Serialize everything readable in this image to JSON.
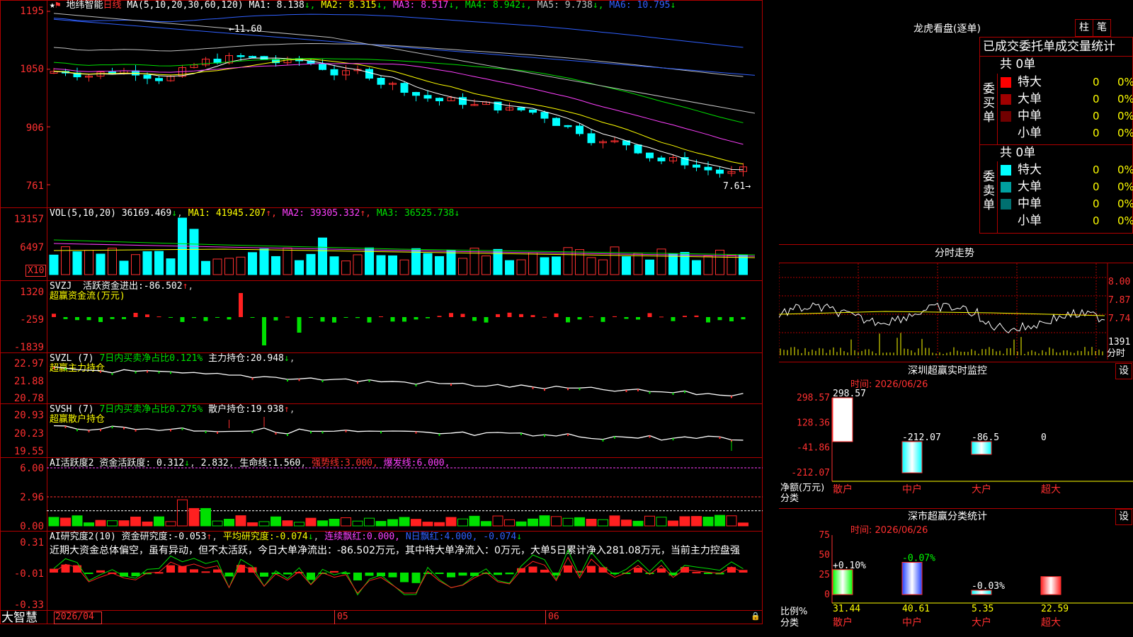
{
  "kline": {
    "stock_name": "地纬智能",
    "period": "日线",
    "ma_params": "MA(5,10,20,30,60,120)",
    "ma": [
      {
        "label": "MA1:",
        "value": "8.138",
        "arrow": "↓",
        "color": "#ffffff"
      },
      {
        "label": "MA2:",
        "value": "8.315",
        "arrow": "↓",
        "color": "#ffff00"
      },
      {
        "label": "MA3:",
        "value": "8.517",
        "arrow": "↓",
        "color": "#ff40ff"
      },
      {
        "label": "MA4:",
        "value": "8.942",
        "arrow": "↓",
        "color": "#00e000"
      },
      {
        "label": "MA5:",
        "value": "9.738",
        "arrow": "↓",
        "color": "#c0c0c0"
      },
      {
        "label": "MA6:",
        "value": "10.795",
        "arrow": "↓",
        "color": "#3060ff"
      }
    ],
    "y_ticks": [
      "1195",
      "1050",
      "906",
      "761"
    ],
    "high_mark": "11.60",
    "low_mark": "7.61"
  },
  "volume": {
    "title": "VOL(5,10,20)",
    "value": "36169.469",
    "arrow": "↓",
    "ma": [
      {
        "label": "MA1:",
        "value": "41945.207",
        "arrow": "↑",
        "color": "#ffff00"
      },
      {
        "label": "MA2:",
        "value": "39305.332",
        "arrow": "↑",
        "color": "#ff40ff"
      },
      {
        "label": "MA3:",
        "value": "36525.738",
        "arrow": "↓",
        "color": "#00e000"
      }
    ],
    "y_ticks": [
      "13157",
      "6497"
    ],
    "unit": "X10"
  },
  "svzj": {
    "title": "SVZJ",
    "label": "活跃资金进出:",
    "value": "-86.502",
    "arrow": "↑",
    "subtitle": "超赢资金流(万元)",
    "y_ticks": [
      "1320",
      "-259",
      "-1839"
    ]
  },
  "svzl": {
    "title": "SVZL (7)",
    "desc": "7日内买卖净占比0.121%",
    "label": "主力持仓:",
    "value": "20.948",
    "arrow": "↓",
    "subtitle": "超赢主力持仓",
    "y_ticks": [
      "22.97",
      "21.88",
      "20.78"
    ]
  },
  "svsh": {
    "title": "SVSH (7)",
    "desc": "7日内买卖净占比0.275%",
    "label": "散户持仓:",
    "value": "19.938",
    "arrow": "↑",
    "subtitle": "超赢散户持仓",
    "y_ticks": [
      "20.93",
      "20.23",
      "19.55"
    ]
  },
  "ai_active": {
    "title": "AI活跃度2",
    "label": "资金活跃度:",
    "v1": "0.312",
    "a1": "↓",
    "v2": "2.832",
    "l3": "生命线:",
    "v3": "1.560",
    "l4": "强势线:",
    "v4": "3.000",
    "l5": "爆发线:",
    "v5": "6.000",
    "y_ticks": [
      "6.00",
      "2.96",
      "0.00"
    ]
  },
  "ai_research": {
    "title": "AI研究度2(10)",
    "label": "资金研究度:",
    "v1": "-0.053",
    "a1": "↑",
    "l2": "平均研究度:",
    "v2": "-0.074",
    "a2": "↓",
    "l3": "连续飘红:",
    "v3": "0.000",
    "l4": "N日飘红:",
    "v4": "4.000",
    "v5": "-0.074",
    "a5": "↓",
    "comment": "近期大资金总体偏空，虽有异动，但不太活跃，今日大单净流出：-86.502万元，其中特大单净流入：0万元，大单5日累计净入281.08万元，当前主力控盘强",
    "y_ticks": [
      "0.31",
      "-0.01",
      "-0.33"
    ]
  },
  "x_axis": {
    "labels": [
      "2026/04",
      "05",
      "06"
    ]
  },
  "brand": "大智慧",
  "dragon": {
    "title": "龙虎看盘(逐单)",
    "btn_zhu": "柱",
    "btn_bi": "笔",
    "tabs": [
      "已成交",
      "委托单",
      "成交量统计"
    ],
    "buy_side": "委买单",
    "sell_side": "委卖单",
    "buy_total": "共 0单",
    "sell_total": "共 0单",
    "buy_rows": [
      {
        "name": "特大",
        "count": "0",
        "pct": "0%",
        "color": "#ff0000"
      },
      {
        "name": "大单",
        "count": "0",
        "pct": "0%",
        "color": "#a00000"
      },
      {
        "name": "中单",
        "count": "0",
        "pct": "0%",
        "color": "#700000"
      },
      {
        "name": "小单",
        "count": "0",
        "pct": "0%",
        "color": "#000000"
      }
    ],
    "sell_rows": [
      {
        "name": "特大",
        "count": "0",
        "pct": "0%",
        "color": "#00ffff"
      },
      {
        "name": "大单",
        "count": "0",
        "pct": "0%",
        "color": "#00a0a0"
      },
      {
        "name": "中单",
        "count": "0",
        "pct": "0%",
        "color": "#007070"
      },
      {
        "name": "小单",
        "count": "0",
        "pct": "0%",
        "color": "#000000"
      }
    ]
  },
  "intraday": {
    "title": "分时走势",
    "y_ticks": [
      "8.00",
      "7.87",
      "7.74"
    ],
    "vol_label": "1391",
    "vol_unit": "分时"
  },
  "sz_monitor": {
    "title": "深圳超赢实时监控",
    "set_btn": "设",
    "time_label": "时间: 2026/06/26",
    "y_ticks": [
      "298.57",
      "128.36",
      "-41.86",
      "-212.07"
    ],
    "axis_label": "净额(万元)",
    "cat_label": "分类",
    "bars": [
      {
        "cat": "散户",
        "value": 298.57,
        "label": "298.57",
        "color": "#ffffff"
      },
      {
        "cat": "中户",
        "value": -212.07,
        "label": "-212.07",
        "color": "#00ffff"
      },
      {
        "cat": "大户",
        "value": -86.5,
        "label": "-86.5",
        "color": "#00ffff"
      },
      {
        "cat": "超大",
        "value": 0,
        "label": "0",
        "color": "#ffffff"
      }
    ]
  },
  "sz_class": {
    "title": "深市超赢分类统计",
    "set_btn": "设",
    "time_label": "时间: 2026/06/26",
    "y_ticks": [
      "75",
      "50",
      "25",
      "0"
    ],
    "axis_label": "比例%",
    "cat_label": "分类",
    "bars": [
      {
        "cat": "散户",
        "value": 31.44,
        "label": "31.44",
        "top": "+0.10%",
        "color": "#00ff00"
      },
      {
        "cat": "中户",
        "value": 40.61,
        "label": "40.61",
        "top": "-0.07%",
        "color": "#2040ff"
      },
      {
        "cat": "大户",
        "value": 5.35,
        "label": "5.35",
        "top": "-0.03%",
        "color": "#00ffff"
      },
      {
        "cat": "超大",
        "value": 22.59,
        "label": "22.59",
        "top": "",
        "color": "#ff2020"
      }
    ]
  }
}
